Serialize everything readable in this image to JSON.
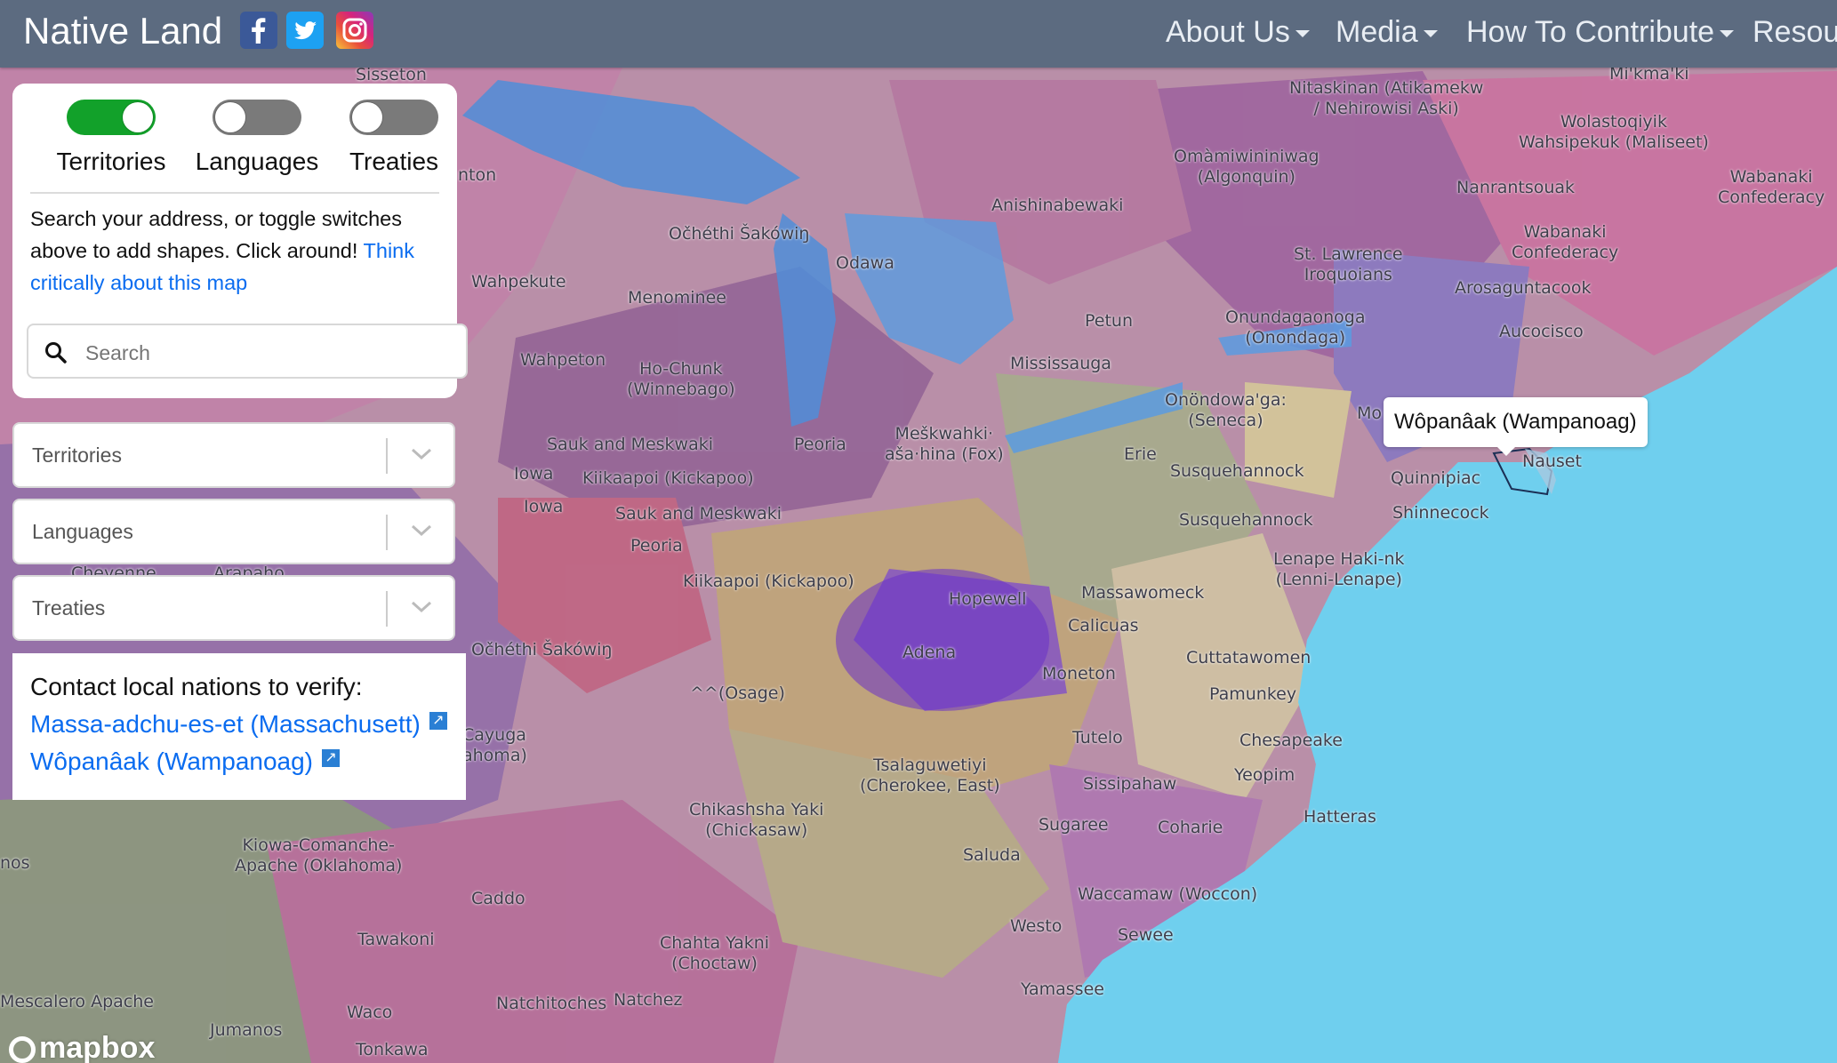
{
  "navbar": {
    "brand": "Native Land",
    "social": [
      {
        "name": "facebook-icon"
      },
      {
        "name": "twitter-icon"
      },
      {
        "name": "instagram-icon"
      }
    ],
    "menu": [
      "About Us",
      "Media",
      "How To Contribute",
      "Resou"
    ]
  },
  "toggles": [
    {
      "label": "Territories",
      "on": true
    },
    {
      "label": "Languages",
      "on": false
    },
    {
      "label": "Treaties",
      "on": false
    }
  ],
  "intro": {
    "text": "Search your address, or toggle switches above to add shapes. Click around!",
    "link": "Think critically about this map"
  },
  "search": {
    "placeholder": "Search"
  },
  "selects": [
    "Territories",
    "Languages",
    "Treaties"
  ],
  "contact": {
    "title": "Contact local nations to verify:",
    "links": [
      "Massa-adchu-es-et (Massachusett)",
      "Wôpanâak (Wampanoag)"
    ]
  },
  "tooltip": "Wôpanâak (Wampanoag)",
  "mapbox": "mapbox",
  "map_labels": [
    "Sisseton",
    "nton",
    "Wahpekute",
    "Wahpeton",
    "Očhéthi Šakówiŋ",
    "Menominee",
    "Odawa",
    "Anishinabewaki",
    "Ho-Chunk\n(Winnebago)",
    "Sauk and Meskwaki",
    "Iowa",
    "Iowa",
    "Kiikaapoi (Kickapoo)",
    "Sauk and Meskwaki",
    "Peoria",
    "Peoria",
    "Meškwahki·\naša·hina (Fox)",
    "Mississauga",
    "Petun",
    "Kiikaapoi (Kickapoo)",
    "Hopewell",
    "Adena",
    "^^(Osage)",
    "Očhéthi Šakówiŋ",
    "Cayuga\nahoma)",
    "Tsalaguwetiyi\n(Cherokee, East)",
    "Chikashsha Yaki\n(Chickasaw)",
    "Kiowa-Comanche-\nApache (Oklahoma)",
    "Caddo",
    "Tawakoni",
    "nos",
    "Mescalero Apache",
    "Jumanos",
    "Waco",
    "Tonkawa",
    "Natchitoches",
    "Natchez",
    "Chahta Yakni\n(Choctaw)",
    "Cheyenne",
    "Arapaho",
    "Nitaskinan (Atikamekw\n/ Nehirowisi Aski)",
    "Mi'kma'ki",
    "Wolastoqiyik\nWahsipekuk (Maliseet)",
    "Omàmiwininiwag\n(Algonquin)",
    "Nanrantsouak",
    "Wabanaki\nConfederacy",
    "Wabanaki\nConfederacy",
    "St. Lawrence\nIroquoians",
    "Arosaguntacook",
    "Onundagaonoga\n(Onondaga)",
    "Aucocisco",
    "Onöndowa'ga:\n(Seneca)",
    "Mo",
    "Erie",
    "Susquehannock",
    "Susquehannock",
    "Quinnipiac",
    "Nauset",
    "Shinnecock",
    "Lenape Haki-nk\n(Lenni-Lenape)",
    "Massawomeck",
    "Calicuas",
    "Cuttatawomen",
    "Moneton",
    "Pamunkey",
    "Tutelo",
    "Chesapeake",
    "Yeopim",
    "Sissipahaw",
    "Hatteras",
    "Sugaree",
    "Coharie",
    "Saluda",
    "Waccamaw (Woccon)",
    "Westo",
    "Sewee",
    "Yamassee"
  ],
  "colors": {
    "navbar": "#5c6b80",
    "ocean": "#6fcfee",
    "toggle_on": "#12a12a",
    "toggle_off": "#7a7a7a",
    "link": "#0a6cf0"
  }
}
